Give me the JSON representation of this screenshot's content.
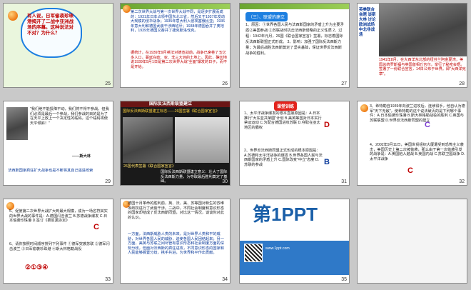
{
  "slides": [
    {
      "num": "25",
      "question": "有人说，日军偷袭珍珠港揭开了二战中亚洲战场的序幕。这种说法对不对？为什么？"
    },
    {
      "num": "26",
      "body": "第二次世界大战与第一次世界大战不同，是逐步扩展而成的：1931年日本占领中国东北三省，然后又于1937年发动大规模的侵华战争；1935年意大利入侵埃塞俄比亚；1936年意大利和德国武装干涉西班牙；1938年德国吞并了奥地利，1939年德国又吞并了捷克斯洛伐克。",
      "body2": "据统计，在1939年9月英法对德宣战前，战争已席卷了五亿多人口，蔓延在欧、亚、非三大洲的土地上。因此，确切地说1939年9月1日是第二次世界大战\"全面\"爆发的日子，而不是开始。"
    },
    {
      "num": "27",
      "heading": "（三）、联盟的建立",
      "body": "1、原因：①世界各国人民与法西斯国家的矛盾上升为主要矛盾②美国参战 ②苏联战时抗击法西斯侵略的正义性质 2、过程：1942年元月，26国《联合国家宣言》签署，标志着国际反法西斯联盟正式形成。 3、影响：加强了国际反法西斯力量；为最后战胜法西斯奠定了坚实基础，保证世界反法西斯战争的胜利。"
    },
    {
      "num": "28",
      "side": "英美联合会晤 谈斯大林 讨论欧洲战场 中北非战场",
      "caption": "1941年8月，在大西洋东北部的纽芬兰阿金夏湾，美国总统罗斯福与英国首相丘吉尔，举行了秘密会晤。签署了一份联合宣言，14日公布于世界。即\"大西洋宪章\"。"
    },
    {
      "num": "29",
      "quote": "\"我们绝不能投降不动，我们将不得不参战，但我们必须是最后一个参战，我们参战的目的是为了在天平上放上一个决定性的砝码，这个砝码将使天平倾斜！\"",
      "author": "——斯大林",
      "caption": "法西斯国家疯狂扩大战争也是不断将其自己逼进绞索"
    },
    {
      "num": "30",
      "heading": "国际反法西斯联盟建立",
      "sub": "国际反法西斯联盟建立标志——26国签署《联合国家宣言》",
      "cap1": "26国代表签署《联合国家宣言》",
      "cap2": "国际反法西斯联盟建立意义：壮大了国际反法西斯力量，为夺取最后胜利奠定了基础。"
    },
    {
      "num": "31",
      "title": "课堂训练",
      "q1": "1、太平洋战争爆发的根本直接原因是：A.日本推行\"大东亚共荣圈\"计划 B.美英等国对日本实行禁运运动 C.为配合德国进攻苏联 D.夺取在亚太地区的霸权",
      "ans1": "D",
      "q2": "2、世界反法西斯同盟正式形成的根本原因是：A.苏德和太平洋战争的爆发 B.世界各国人民与法西斯国家的矛盾上升 C.国际改变\"中立\"态度 D.苏联的参战",
      "ans2": "B"
    },
    {
      "num": "32",
      "q1": "3、希特勒自1939年向波兰进攻后，连续得手，他自认为德军\"天下无敌\"，使希特勒的这个说法破灭的是下列哪个事件：A.日本偷袭珍珠港 B.斯大林格勒战役的胜利 C.英国与苏联联盟 D.世界反法西斯同盟的建立",
      "ans1": "C",
      "q2": "4、2002年9月11日，美国世贸组织大厦遭受到恐怖主义袭击，美国历史上第二次被偷袭，那么由于第一次偷袭引发的战争是：A.美国陷入越战 B.美国内战 C.苏联卫国战争 D.太平洋战争",
      "ans2": "C"
    },
    {
      "num": "33",
      "q1": "5、促使第二次世界大战扩大到最大规模，成为一场名符其实的世界大战的事件是：A.德国闪击波兰 B.苏德战争爆发 C.日本偷袭珍珠港 D.签订《慕尼黑协定》",
      "ans1": "C",
      "q2": "6、请你按照时间顺序排列下列事件 ①德军突袭苏联 ②德军闪击波兰 ③日军偷袭珍珠港 ④斯大林格勒战役",
      "order": "②①③④"
    },
    {
      "num": "34",
      "body": "德国十月革命的胜利前，英、法、美、苏等国对新生的苏维埃政权进行了武装干涉。二战中，不同社会制度和意识形态的国家却结成了反法西斯同盟，对比这一情况，谈谈你对此的认识。",
      "body2": "一方面，法西斯威胁人类的未来，是对世界人类和平的威胁，对世界各国人民的威胁，迫使各国人民团结起来；另一方面，美英与苏联之间尽管有意识形态和社会制度方面的深刻分歧，但面对法西斯的疯狂进攻，不同意识形态的国家和人民能够搁置分歧，携手共进，为世界和平作出贡献。"
    },
    {
      "num": "35",
      "logo": "第1PPT",
      "url": "www.1ppt.com"
    }
  ]
}
